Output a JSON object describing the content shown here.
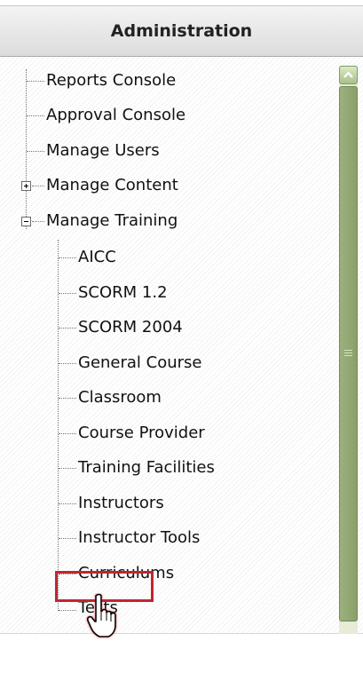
{
  "panel": {
    "title": "Administration"
  },
  "tree": {
    "top_items": [
      "Reports Console",
      "Approval Console",
      "Manage Users",
      "Manage Content",
      "Manage Training"
    ],
    "top_states": [
      "leaf",
      "leaf",
      "leaf",
      "collapsed",
      "expanded"
    ],
    "training_items": [
      "AICC",
      "SCORM 1.2",
      "SCORM 2004",
      "General Course",
      "Classroom",
      "Course Provider",
      "Training Facilities",
      "Instructors",
      "Instructor Tools",
      "Curriculums",
      "Tests"
    ],
    "highlighted_item": "Tests"
  },
  "colors": {
    "scrollbar": "#8aa06a",
    "highlight": "#c0262f"
  },
  "icons": {
    "cursor": "hand-pointer-icon"
  }
}
